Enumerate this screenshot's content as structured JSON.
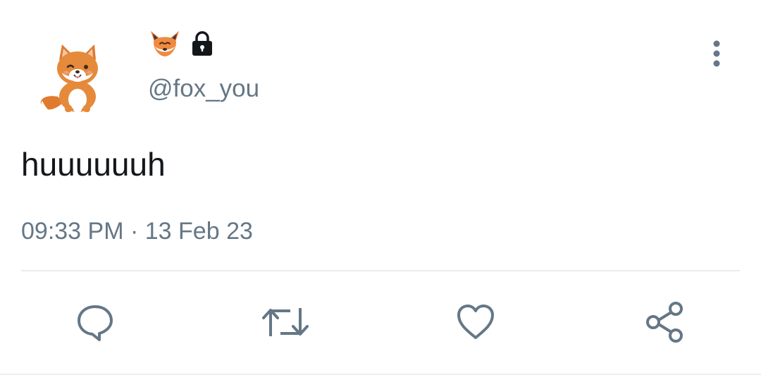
{
  "user": {
    "avatar_icon": "shiba-fox-sticker-icon",
    "name_emoji_icon": "fox-face-emoji-icon",
    "lock_icon": "lock-icon",
    "handle": "@fox_you"
  },
  "tweet": {
    "text": "huuuuuuh",
    "time": "09:33 PM",
    "separator": "·",
    "date": "13 Feb 23"
  },
  "actions": {
    "reply_icon": "reply-bubble-icon",
    "retweet_icon": "retweet-icon",
    "like_icon": "heart-icon",
    "share_icon": "share-icon",
    "more_icon": "more-vertical-icon"
  },
  "colors": {
    "secondary_text": "#657786",
    "icon": "#657786",
    "primary_text": "#14171a",
    "divider": "#e6ecf0"
  }
}
